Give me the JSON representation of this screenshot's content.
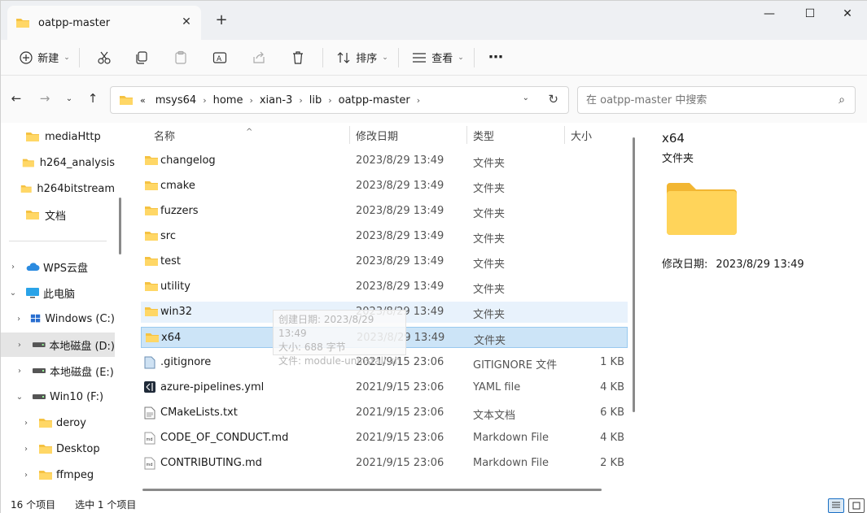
{
  "window": {
    "tab_title": "oatpp-master",
    "colors": {
      "accent": "#0067c0",
      "folder": "#f5c242",
      "selection": "#cce4f7"
    }
  },
  "toolbar": {
    "new_label": "新建",
    "sort_label": "排序",
    "view_label": "查看",
    "icons": [
      "cut-icon",
      "copy-icon",
      "paste-icon",
      "rename-icon",
      "share-icon",
      "delete-icon"
    ]
  },
  "address": {
    "overflow": "«",
    "crumbs": [
      "msys64",
      "home",
      "xian-3",
      "lib",
      "oatpp-master"
    ]
  },
  "search": {
    "placeholder": "在 oatpp-master 中搜索"
  },
  "sidebar": {
    "items": [
      {
        "label": "mediaHttp"
      },
      {
        "label": "h264_analysis"
      },
      {
        "label": "h264bitstream"
      },
      {
        "label": "文档"
      },
      {
        "label": "WPS云盘"
      },
      {
        "label": "此电脑"
      },
      {
        "label": "Windows (C:)"
      },
      {
        "label": "本地磁盘 (D:)"
      },
      {
        "label": "本地磁盘 (E:)"
      },
      {
        "label": "Win10 (F:)"
      },
      {
        "label": "deroy"
      },
      {
        "label": "Desktop"
      },
      {
        "label": "ffmpeg"
      }
    ]
  },
  "list": {
    "headers": {
      "name": "名称",
      "date": "修改日期",
      "type": "类型",
      "size": "大小"
    },
    "rows": [
      {
        "name": "changelog",
        "date": "2023/8/29 13:49",
        "type": "文件夹",
        "size": ""
      },
      {
        "name": "cmake",
        "date": "2023/8/29 13:49",
        "type": "文件夹",
        "size": ""
      },
      {
        "name": "fuzzers",
        "date": "2023/8/29 13:49",
        "type": "文件夹",
        "size": ""
      },
      {
        "name": "src",
        "date": "2023/8/29 13:49",
        "type": "文件夹",
        "size": ""
      },
      {
        "name": "test",
        "date": "2023/8/29 13:49",
        "type": "文件夹",
        "size": ""
      },
      {
        "name": "utility",
        "date": "2023/8/29 13:49",
        "type": "文件夹",
        "size": ""
      },
      {
        "name": "win32",
        "date": "2023/8/29 13:49",
        "type": "文件夹",
        "size": ""
      },
      {
        "name": "x64",
        "date": "2023/8/29 13:49",
        "type": "文件夹",
        "size": ""
      },
      {
        "name": ".gitignore",
        "date": "2021/9/15 23:06",
        "type": "GITIGNORE 文件",
        "size": "1 KB"
      },
      {
        "name": "azure-pipelines.yml",
        "date": "2021/9/15 23:06",
        "type": "YAML file",
        "size": "4 KB"
      },
      {
        "name": "CMakeLists.txt",
        "date": "2021/9/15 23:06",
        "type": "文本文档",
        "size": "6 KB"
      },
      {
        "name": "CODE_OF_CONDUCT.md",
        "date": "2021/9/15 23:06",
        "type": "Markdown File",
        "size": "4 KB"
      },
      {
        "name": "CONTRIBUTING.md",
        "date": "2021/9/15 23:06",
        "type": "Markdown File",
        "size": "2 KB"
      }
    ]
  },
  "tooltip": {
    "created": "创建日期: 2023/8/29 13:49",
    "size": "大小: 688 字节",
    "files": "文件: module-uninstall.sh"
  },
  "detail": {
    "name": "x64",
    "type": "文件夹",
    "modified_label": "修改日期:",
    "modified_value": "2023/8/29 13:49"
  },
  "status": {
    "count": "16 个项目",
    "selected": "选中 1 个项目"
  }
}
